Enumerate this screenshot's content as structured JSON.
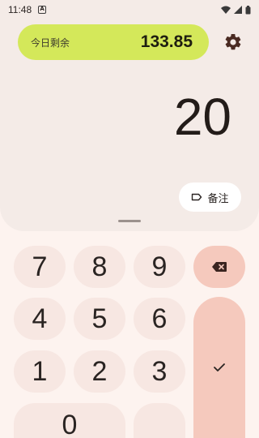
{
  "status": {
    "time": "11:48",
    "notification": "A"
  },
  "budget": {
    "label": "今日剩余",
    "value": "133.85"
  },
  "display": {
    "amount": "20"
  },
  "memo": {
    "label": "备注"
  },
  "keypad": {
    "k7": "7",
    "k8": "8",
    "k9": "9",
    "k4": "4",
    "k5": "5",
    "k6": "6",
    "k1": "1",
    "k2": "2",
    "k3": "3",
    "k0": "0"
  },
  "icons": {
    "settings": "gear-icon",
    "delete": "backspace-icon",
    "confirm": "check-icon",
    "memo": "tag-icon"
  },
  "colors": {
    "budget_pill": "#d4e85a",
    "key": "#f7e7e2",
    "action_key": "#f5c9bd",
    "top_panel": "#f4ebe7"
  }
}
